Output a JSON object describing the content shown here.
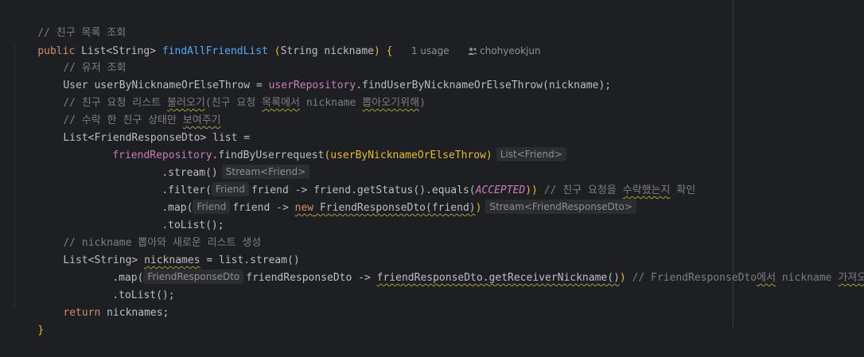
{
  "code": {
    "l1": {
      "comment": "// 친구 목록 조회"
    },
    "l2": {
      "kw_public": "public",
      "ret_a": "List<String>",
      "method": "findAllFriendList",
      "paren_open": "(",
      "param_type": "String",
      "param_name": "nickname",
      "paren_close": ")",
      "brace": "{",
      "usage": "1 usage",
      "author": "chohyeokjun"
    },
    "l3": {
      "comment": "// 유저 조회"
    },
    "l4": {
      "type": "User",
      "var": "userByNicknameOrElseThrow",
      "eq": " = ",
      "field": "userRepository",
      "dot": ".",
      "call": "findUserByNicknameOrElseThrow",
      "args": "(nickname);"
    },
    "l5": {
      "c1": "// 친구 요청 리스트 ",
      "c2": "불러오기",
      "c3": "(친구 요청 ",
      "c4": "목록에서",
      "c5": " nickname ",
      "c6": "뽑아오기위해",
      "c7": ")"
    },
    "l6": {
      "c1": "// 수락 한 친구 상태만 ",
      "c2": "보여주기"
    },
    "l7": {
      "a": "List<FriendResponseDto> list ="
    },
    "l8": {
      "field": "friendRepository",
      "call": ".findByUserrequest",
      "args": "(userByNicknameOrElseThrow)",
      "hint": "List<Friend>"
    },
    "l9": {
      "call": ".stream()",
      "hint": "Stream<Friend>"
    },
    "l10": {
      "call": ".filter(",
      "hint_pre": "Friend",
      "body": "friend -> friend.getStatus().equals(",
      "const": "ACCEPTED",
      "close": "))",
      "c1": " // 친구 요청을 ",
      "c2": "수락했는지",
      "c3": " 확인"
    },
    "l11": {
      "call": ".map(",
      "hint_pre": "Friend",
      "body": "friend -> ",
      "kw_new": "new",
      "ctor": " FriendResponseDto(friend)",
      "close": ")",
      "hint": "Stream<FriendResponseDto>"
    },
    "l12": {
      "call": ".toList();"
    },
    "l13": {
      "comment": "// nickname 뽑아와 새로운 리스트 생성"
    },
    "l14": {
      "type": "List<String> ",
      "var": "nicknames",
      "rest": " = list.stream()"
    },
    "l15": {
      "call": ".map(",
      "hint_pre": "FriendResponseDto",
      "body": "friendResponseDto -> ",
      "ref": "friendResponseDto.getReceiverNickname()",
      "close": ")",
      "c1": " // FriendResponseDto",
      "c2": "에서",
      "c3": " nickname ",
      "c4": "가져오기"
    },
    "l16": {
      "call": ".toList();"
    },
    "l17": {
      "kw_return": "return",
      "rest": " nicknames;"
    },
    "l18": {
      "brace": "}"
    }
  },
  "colors": {
    "background": "#1e1f22",
    "keyword": "#cf8e6d",
    "comment": "#7a7e85",
    "method": "#56a8f5",
    "field": "#c77dbb",
    "text": "#bcbec4"
  }
}
